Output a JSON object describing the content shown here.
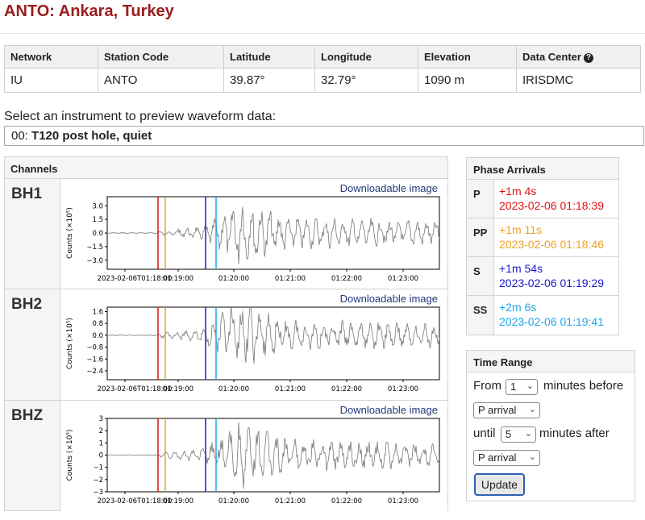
{
  "page": {
    "title": "ANTO: Ankara, Turkey"
  },
  "station_table": {
    "headers": [
      "Network",
      "Station Code",
      "Latitude",
      "Longitude",
      "Elevation",
      "Data Center"
    ],
    "values": [
      "IU",
      "ANTO",
      "39.87°",
      "32.79°",
      "1090 m",
      "IRISDMC"
    ]
  },
  "instrument": {
    "prompt": "Select an instrument to preview waveform data:",
    "selected_prefix": "00: ",
    "selected_name": "T120 post hole, quiet"
  },
  "channels": {
    "header": "Channels",
    "download_label": "Downloadable image",
    "ylabel": "Counts (×10⁵)",
    "xticks": [
      "2023-02-06T01:18:00",
      "01:19:00",
      "01:20:00",
      "01:21:00",
      "01:22:00",
      "01:23:00"
    ],
    "items": [
      {
        "name": "BH1",
        "yticks": [
          "3.0",
          "1.5",
          "0.0",
          "−1.5",
          "−3.0"
        ],
        "ylim": [
          -4.0,
          4.0
        ]
      },
      {
        "name": "BH2",
        "yticks": [
          "1.6",
          "0.8",
          "0.0",
          "−0.8",
          "−1.6",
          "−2.4"
        ],
        "ylim": [
          -3.0,
          1.9
        ]
      },
      {
        "name": "BHZ",
        "yticks": [
          "3",
          "2",
          "1",
          "0",
          "−1",
          "−2",
          "−3"
        ],
        "ylim": [
          -3.0,
          3.0
        ]
      }
    ]
  },
  "phase_arrivals": {
    "header": "Phase Arrivals",
    "items": [
      {
        "phase": "P",
        "relative": "+1m 4s",
        "time": "2023-02-06 01:18:39",
        "color": "#e01010"
      },
      {
        "phase": "PP",
        "relative": "+1m 11s",
        "time": "2023-02-06 01:18:46",
        "color": "#f0a020"
      },
      {
        "phase": "S",
        "relative": "+1m 54s",
        "time": "2023-02-06 01:19:29",
        "color": "#1a1ad0"
      },
      {
        "phase": "SS",
        "relative": "+2m 6s",
        "time": "2023-02-06 01:19:41",
        "color": "#1aa8ee"
      }
    ]
  },
  "time_range": {
    "header": "Time Range",
    "from_label": "From",
    "before_value": "1",
    "before_label": "minutes before",
    "start_phase": "P arrival",
    "until_label": "until",
    "after_value": "5",
    "after_label": "minutes after",
    "end_phase": "P arrival",
    "update_label": "Update"
  }
}
